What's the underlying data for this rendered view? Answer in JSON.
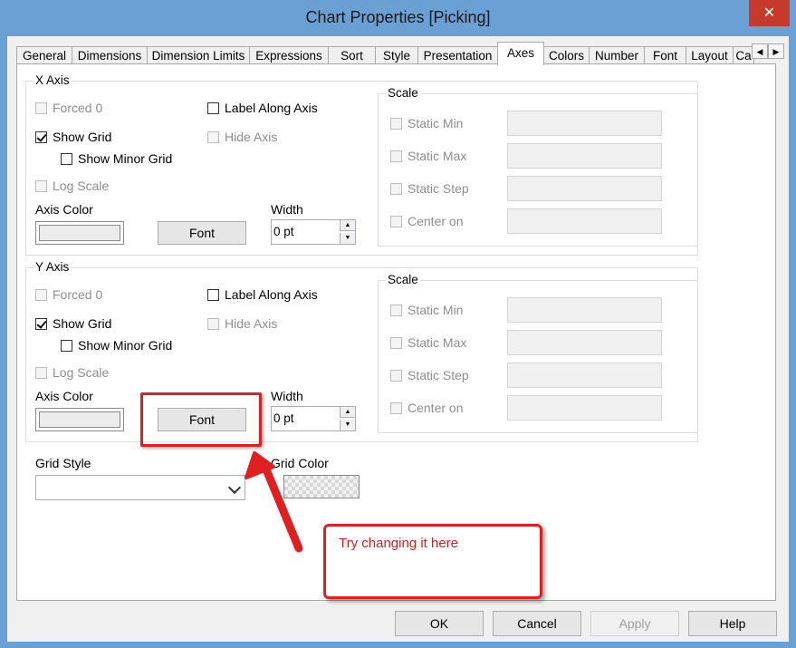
{
  "window": {
    "title": "Chart Properties [Picking]",
    "close_glyph": "✕"
  },
  "tabs": [
    {
      "label": "General"
    },
    {
      "label": "Dimensions"
    },
    {
      "label": "Dimension Limits"
    },
    {
      "label": "Expressions"
    },
    {
      "label": "Sort"
    },
    {
      "label": "Style"
    },
    {
      "label": "Presentation"
    },
    {
      "label": "Axes"
    },
    {
      "label": "Colors"
    },
    {
      "label": "Number"
    },
    {
      "label": "Font"
    },
    {
      "label": "Layout"
    },
    {
      "label": "Ca"
    }
  ],
  "active_tab": "Axes",
  "x_axis": {
    "group_label": "X Axis",
    "forced0": "Forced 0",
    "label_along_axis": "Label Along Axis",
    "show_grid": "Show Grid",
    "hide_axis": "Hide Axis",
    "show_minor_grid": "Show Minor Grid",
    "log_scale": "Log Scale",
    "axis_color_label": "Axis Color",
    "font_button": "Font",
    "width_label": "Width",
    "width_value": "0 pt",
    "scale": {
      "label": "Scale",
      "static_min": "Static Min",
      "static_max": "Static Max",
      "static_step": "Static Step",
      "center_on": "Center on"
    }
  },
  "y_axis": {
    "group_label": "Y Axis",
    "forced0": "Forced 0",
    "label_along_axis": "Label Along Axis",
    "show_grid": "Show Grid",
    "hide_axis": "Hide Axis",
    "show_minor_grid": "Show Minor Grid",
    "log_scale": "Log Scale",
    "axis_color_label": "Axis Color",
    "font_button": "Font",
    "width_label": "Width",
    "width_value": "0 pt",
    "scale": {
      "label": "Scale",
      "static_min": "Static Min",
      "static_max": "Static Max",
      "static_step": "Static Step",
      "center_on": "Center on"
    }
  },
  "grid": {
    "style_label": "Grid Style",
    "style_value": "",
    "color_label": "Grid Color"
  },
  "annotation": {
    "text": "Try changing it here",
    "color": "#e02020"
  },
  "footer": {
    "ok": "OK",
    "cancel": "Cancel",
    "apply": "Apply",
    "help": "Help"
  }
}
